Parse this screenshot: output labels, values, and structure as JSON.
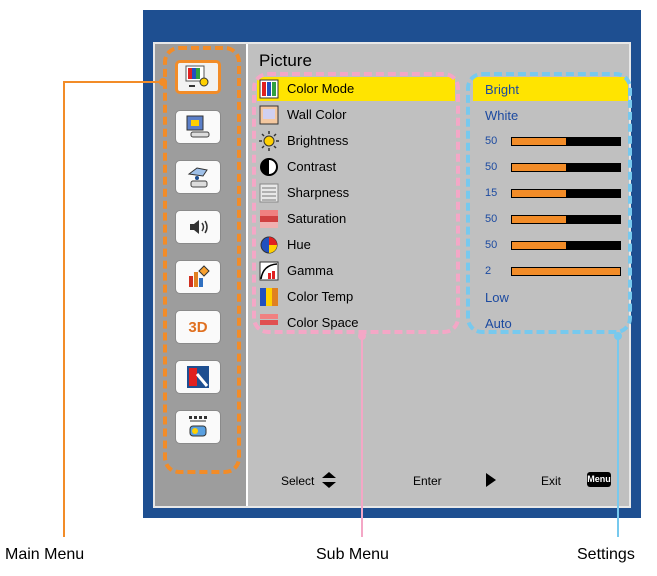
{
  "osd": {
    "title": "Picture",
    "main_menu": [
      {
        "icon": "picture-icon",
        "selected": true
      },
      {
        "icon": "display-icon",
        "selected": false
      },
      {
        "icon": "setup-icon",
        "selected": false
      },
      {
        "icon": "volume-icon",
        "selected": false
      },
      {
        "icon": "options-icon",
        "selected": false
      },
      {
        "icon": "3d-icon",
        "label": "3D",
        "selected": false
      },
      {
        "icon": "interactive-icon",
        "selected": false
      },
      {
        "icon": "network-icon",
        "selected": false
      }
    ],
    "sub_menu": [
      {
        "label": "Color Mode",
        "icon": "color-mode-icon",
        "selected": true
      },
      {
        "label": "Wall Color",
        "icon": "wall-color-icon"
      },
      {
        "label": "Brightness",
        "icon": "brightness-icon"
      },
      {
        "label": "Contrast",
        "icon": "contrast-icon"
      },
      {
        "label": "Sharpness",
        "icon": "sharpness-icon"
      },
      {
        "label": "Saturation",
        "icon": "saturation-icon"
      },
      {
        "label": "Hue",
        "icon": "hue-icon"
      },
      {
        "label": "Gamma",
        "icon": "gamma-icon"
      },
      {
        "label": "Color Temp",
        "icon": "color-temp-icon"
      },
      {
        "label": "Color Space",
        "icon": "color-space-icon"
      }
    ],
    "settings": [
      {
        "type": "text",
        "value": "Bright",
        "selected": true
      },
      {
        "type": "text",
        "value": "White"
      },
      {
        "type": "slider",
        "value": "50",
        "level": 0.5
      },
      {
        "type": "slider",
        "value": "50",
        "level": 0.5
      },
      {
        "type": "slider",
        "value": "15",
        "level": 0.5
      },
      {
        "type": "slider",
        "value": "50",
        "level": 0.5
      },
      {
        "type": "slider",
        "value": "50",
        "level": 0.5
      },
      {
        "type": "slider",
        "value": "2",
        "level": 1.0
      },
      {
        "type": "text",
        "value": "Low"
      },
      {
        "type": "text",
        "value": "Auto"
      }
    ],
    "footer": {
      "select": "Select",
      "enter": "Enter",
      "exit": "Exit",
      "menu_key": "Menu"
    }
  },
  "callouts": {
    "main_menu": "Main Menu",
    "sub_menu": "Sub Menu",
    "settings": "Settings"
  },
  "colors": {
    "frame_blue": "#1e4f91",
    "highlight_yellow": "#ffe400",
    "main_orange": "#f28c28",
    "sub_pink": "#f4a7c6",
    "settings_blue": "#77c9ee",
    "value_blue": "#1c4aa0"
  }
}
